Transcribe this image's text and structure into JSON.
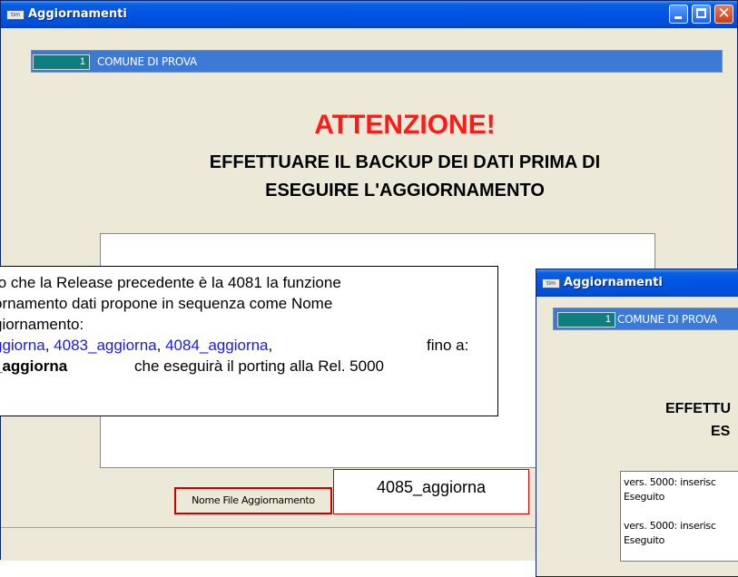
{
  "window1": {
    "title": "Aggiornamenti",
    "icon_text": "tim",
    "close_glyph": "✕",
    "comune_code": "1",
    "comune_name": "COMUNE DI PROVA",
    "attenzione": "ATTENZIONE!",
    "subtitle_line1": "EFFETTUARE IL BACKUP DEI DATI PRIMA DI",
    "subtitle_line2": "ESEGUIRE L'AGGIORNAMENTO",
    "file_label": "Nome File Aggiornamento",
    "file_value": "4085_aggiorna"
  },
  "window2": {
    "title": "Aggiornamenti",
    "icon_text": "tim",
    "comune_code": "1",
    "comune_name": "COMUNE DI PROVA",
    "subtitle_line1": "EFFETTU",
    "subtitle_line2": "ES",
    "log": [
      {
        "line1": "vers. 5000: inserisc",
        "line2": "Eseguito"
      },
      {
        "line1": "vers. 5000: inserisc",
        "line2": "Eseguito"
      }
    ]
  },
  "callout": {
    "line1": "to che la Release precedente è la 4081 la funzione",
    "line2": "ornamento dati propone in sequenza come Nome",
    "line3": "giornamento:",
    "line4": {
      "part1": "ggiorna",
      "sep1": ", ",
      "part2": "4083_aggiorna",
      "sep2": ", ",
      "part3": "4084_aggiorna",
      "sep3": ",",
      "tail": "fino a:"
    },
    "line5": {
      "bold": "_aggiorna",
      "tail": "che eseguirà il porting alla Rel. 5000"
    }
  },
  "colors": {
    "attenzione": "#ff1a1a",
    "title_bar": "#0054e3",
    "comune_bar": "#3c7ad6",
    "code_box": "#0d7f7f",
    "highlight_border": "#d00000",
    "link_blue": "#1a1ae6"
  }
}
